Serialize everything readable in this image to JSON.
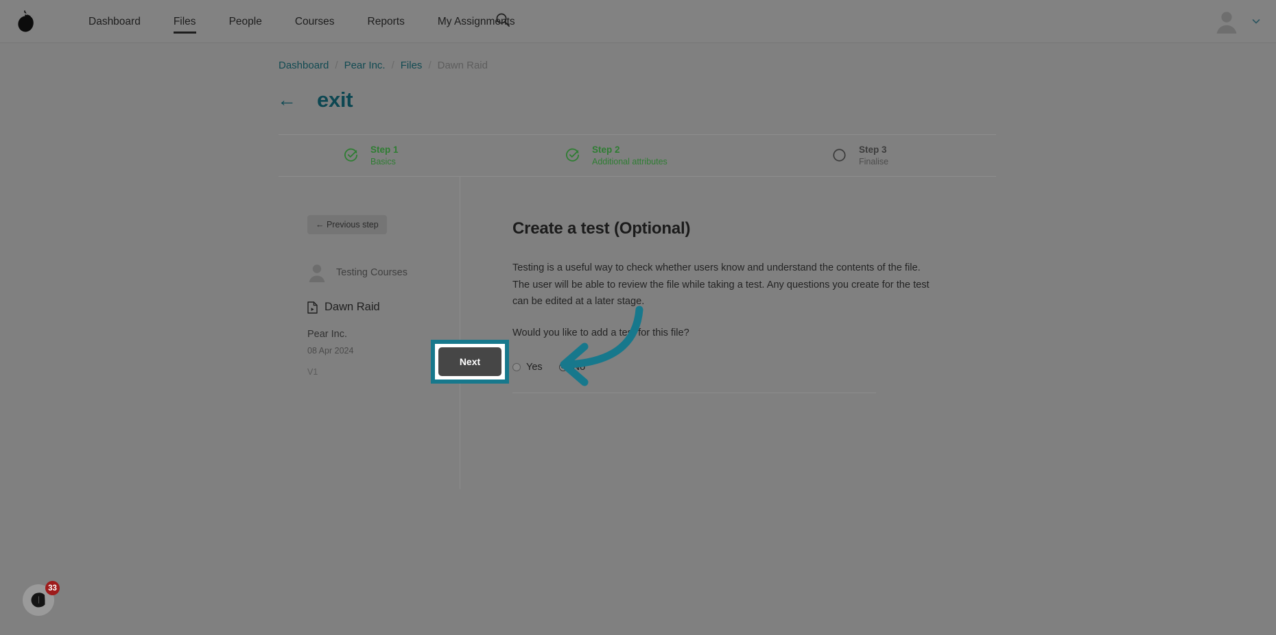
{
  "app": {
    "logo_icon": "pear-logo-icon",
    "accent_teal": "#17788c",
    "link_teal": "#0d4752",
    "step_done_green": "#2e7d32",
    "badge_red": "#9e1b1b",
    "page_background": "#808080"
  },
  "topnav": {
    "items": [
      {
        "label": "Dashboard",
        "active": false
      },
      {
        "label": "Files",
        "active": true
      },
      {
        "label": "People",
        "active": false
      },
      {
        "label": "Courses",
        "active": false
      },
      {
        "label": "Reports",
        "active": false
      },
      {
        "label": "My Assignments",
        "active": false
      }
    ],
    "search_icon": "search-icon",
    "avatar_icon": "user-avatar-icon",
    "avatar_chevron": "chevron-down-icon"
  },
  "breadcrumb": {
    "items": [
      {
        "label": "Dashboard",
        "link": true
      },
      {
        "label": "Pear Inc.",
        "link": true
      },
      {
        "label": "Files",
        "link": true
      },
      {
        "label": "Dawn Raid",
        "link": false
      }
    ],
    "separator": "/"
  },
  "header": {
    "back_arrow": "←",
    "title": "exit"
  },
  "steps": [
    {
      "title": "Step 1",
      "sub": "Basics",
      "state": "done",
      "icon": "check-circle-icon"
    },
    {
      "title": "Step 2",
      "sub": "Additional attributes",
      "state": "done",
      "icon": "check-circle-icon"
    },
    {
      "title": "Step 3",
      "sub": "Finalise",
      "state": "todo",
      "icon": "empty-circle-icon"
    }
  ],
  "sidebar": {
    "previous_step_label": "← Previous step",
    "owner_name": "Testing Courses",
    "owner_icon": "user-avatar-icon",
    "file_name": "Dawn Raid",
    "file_icon": "document-video-icon",
    "organisation": "Pear Inc.",
    "date": "08 Apr 2024",
    "version": "V1"
  },
  "main": {
    "title": "Create a test (Optional)",
    "paragraph": "Testing is a useful way to check whether users know and understand the contents of the file. The user will be able to review the file while taking a test. Any questions you create for the test can be edited at a later stage.",
    "question": "Would you like to add a test for this file?",
    "radio_options": [
      {
        "label": "Yes",
        "checked": false
      },
      {
        "label": "No",
        "checked": true
      }
    ],
    "next_label": "Next"
  },
  "annotation": {
    "arrow_icon": "curved-arrow-left-icon",
    "arrow_color": "#17788c",
    "highlight_color": "#17788c"
  },
  "chat_widget": {
    "icon": "chat-bubble-icon",
    "badge_count": "33"
  }
}
